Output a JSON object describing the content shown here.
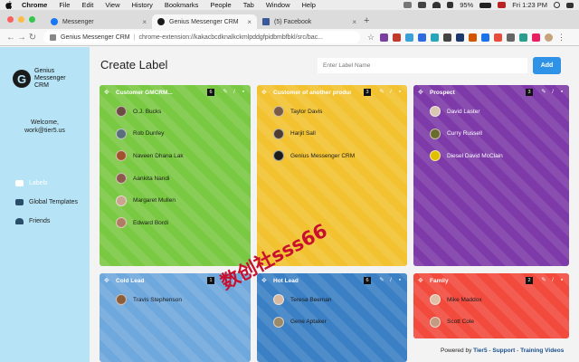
{
  "menubar": {
    "items": [
      "Chrome",
      "File",
      "Edit",
      "View",
      "History",
      "Bookmarks",
      "People",
      "Tab",
      "Window",
      "Help"
    ],
    "battery": "95%",
    "clock": "Fri 1:23 PM"
  },
  "tabs": [
    {
      "title": "Messenger",
      "icon": "messenger-icon",
      "color": "#1877f2"
    },
    {
      "title": "Genius Messenger CRM",
      "icon": "genius-icon",
      "color": "#1b1b1b"
    },
    {
      "title": "(5) Facebook",
      "icon": "facebook-icon",
      "color": "#3b5998"
    }
  ],
  "omnibox": {
    "site": "Genius Messenger CRM",
    "url": "chrome-extension://kakacbcdknalkckmlpddgfpidbmbfbkl/src/bac..."
  },
  "sidebar": {
    "logo_mark": "G",
    "logo_line1": "Genius",
    "logo_line2": "Messenger",
    "logo_line3": "CRM",
    "welcome": "Welcome,",
    "email": "work@tier5.us",
    "nav": [
      {
        "label": "Labels",
        "icon": "tag-icon"
      },
      {
        "label": "Global Templates",
        "icon": "templates-icon"
      },
      {
        "label": "Friends",
        "icon": "friends-icon"
      }
    ]
  },
  "main": {
    "title": "Create Label",
    "input_placeholder": "Enter Label Name",
    "add_label": "Add"
  },
  "cards": [
    {
      "title": "Customer GMCRM...",
      "count": "6",
      "color": "#7ac943",
      "members": [
        "O.J. Bucks",
        "Rob Dunfey",
        "Naveen Dhana Lak",
        "Aankita Nandi",
        "Margaret Mullen",
        "Edward Bordi"
      ]
    },
    {
      "title": "Customer of another product...",
      "count": "3",
      "color": "#f2c230",
      "members": [
        "Taylor Davis",
        "Harjit Sall",
        "Genius Messenger CRM"
      ]
    },
    {
      "title": "Prospect",
      "count": "3",
      "color": "#7d3aa8",
      "members": [
        "David Laster",
        "Curry Russell",
        "Diesel David McClain"
      ]
    },
    {
      "title": "Cold Lead",
      "count": "1",
      "color": "#6fa8dc",
      "members": [
        "Travis Stephenson"
      ]
    },
    {
      "title": "Hot Lead",
      "count": "6",
      "color": "#3b7fc4",
      "members": [
        "Teresa Beeman",
        "Gene Aptaker"
      ]
    },
    {
      "title": "Family",
      "count": "2",
      "color": "#f24a3d",
      "members": [
        "Mike Maddox",
        "Scott Cole"
      ]
    }
  ],
  "watermark": "数创社sss66",
  "footer": {
    "powered": "Powered by",
    "brand": "Tier5",
    "dash": "-",
    "support": "Support",
    "training": "Training Videos"
  }
}
